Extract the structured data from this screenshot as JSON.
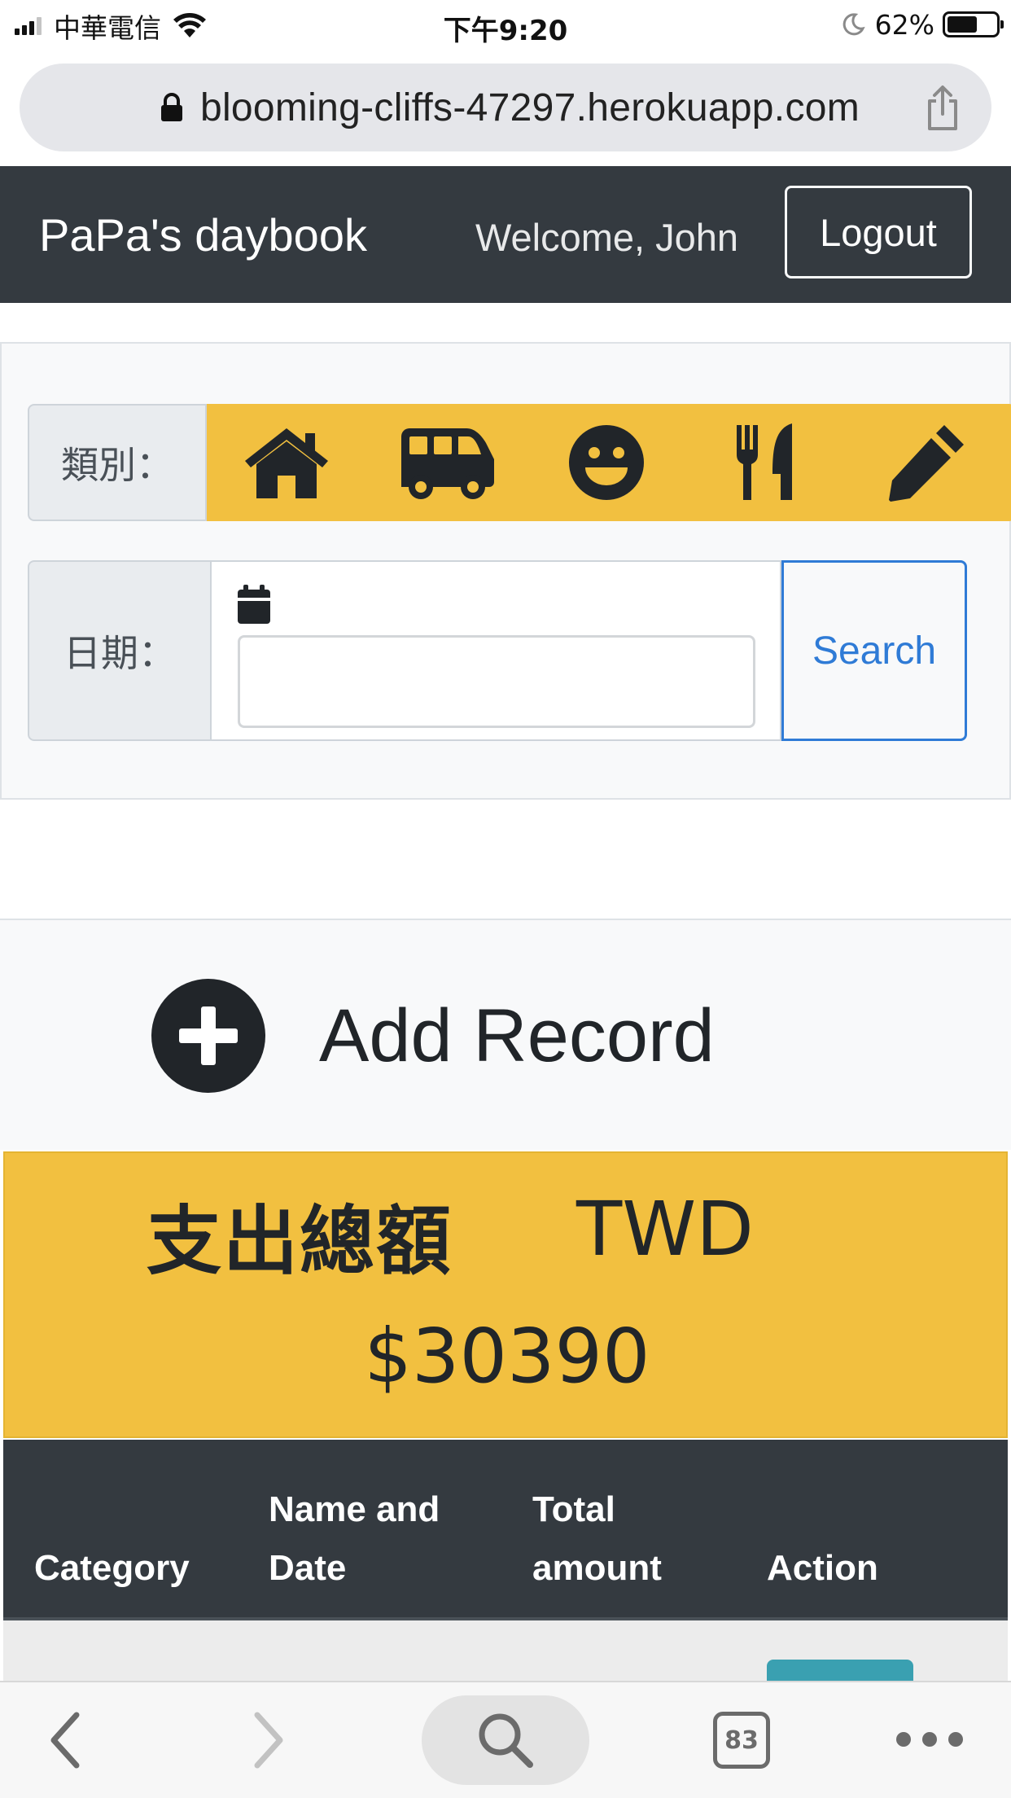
{
  "status_bar": {
    "carrier": "中華電信",
    "time": "下午9:20",
    "battery_percent": "62%",
    "battery_level": 0.62
  },
  "url_bar": {
    "url": "blooming-cliffs-47297.herokuapp.com",
    "lock_icon": "lock-icon",
    "share_icon": "share-icon"
  },
  "navbar": {
    "brand": "PaPa's daybook",
    "welcome": "Welcome, John",
    "logout_label": "Logout",
    "background": "#343a40"
  },
  "filter": {
    "category_label": "類別：",
    "categories": [
      {
        "icon": "home-icon"
      },
      {
        "icon": "van-icon"
      },
      {
        "icon": "smile-icon"
      },
      {
        "icon": "utensils-icon"
      },
      {
        "icon": "pencil-icon"
      }
    ],
    "category_strip_color": "#f2c040",
    "date_label": "日期：",
    "date_value": "",
    "search_label": "Search",
    "search_color": "#2f7bd6"
  },
  "add_record": {
    "label": "Add Record",
    "icon": "plus-circle-icon"
  },
  "total": {
    "label": "支出總額",
    "currency": "TWD",
    "amount": "$30390",
    "background": "#f2c040"
  },
  "table": {
    "columns": [
      {
        "line1": "",
        "line2": "Category"
      },
      {
        "line1": "Name and",
        "line2": "Date"
      },
      {
        "line1": "Total",
        "line2": "amount"
      },
      {
        "line1": "",
        "line2": "Action"
      }
    ]
  },
  "toolbar": {
    "back_icon": "chevron-left-icon",
    "forward_icon": "chevron-right-icon",
    "search_icon": "search-icon",
    "tab_count": "83",
    "more_icon": "more-icon"
  }
}
